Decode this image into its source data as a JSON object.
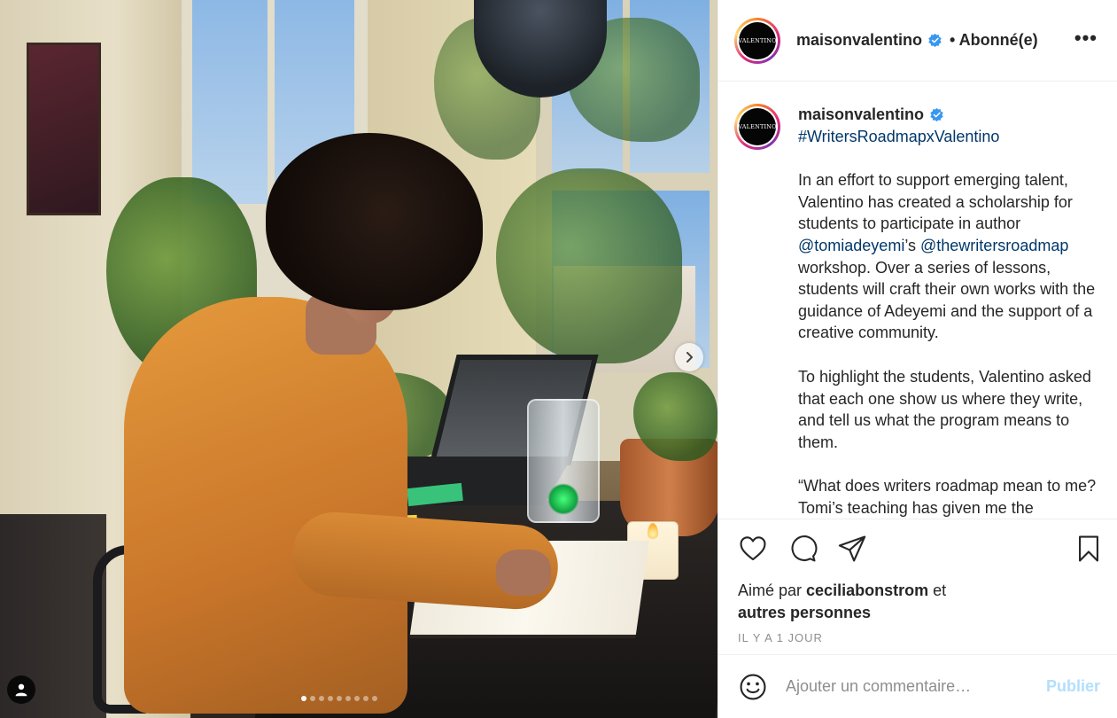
{
  "post": {
    "username": "maisonvalentino",
    "follow_status": "• Abonné(e)",
    "more_label": "•••",
    "avatar_text": "VALENTINO"
  },
  "caption": {
    "username": "maisonvalentino",
    "hashtag": "#WritersRoadmapxValentino",
    "p1_a": "In an effort to support emerging talent, Valentino has created a scholarship for students to participate in author ",
    "mention1": "@tomiadeyemi",
    "p1_b": "’s ",
    "mention2": "@thewritersroadmap",
    "p1_c": " workshop. Over a series of lessons, students will craft their own works with the guidance of Adeyemi and the support of a creative community.",
    "p2": "To highlight the students, Valentino asked that each one show us where they write, and tell us what the program means to them.",
    "p3": "“What does writers roadmap mean to me? Tomi’s teaching has given me the"
  },
  "likes": {
    "prefix": "Aimé par ",
    "user": "ceciliabonstrom",
    "suffix": " et",
    "others": "autres personnes"
  },
  "timestamp": "IL Y A 1 JOUR",
  "comment_box": {
    "placeholder": "Ajouter un commentaire…",
    "publish_label": "Publier"
  },
  "carousel": {
    "total": 9,
    "active_index": 0
  },
  "colors": {
    "link": "#00376b",
    "verified": "#3897f0",
    "publish_disabled": "#b2dffc",
    "timestamp": "#8e8e8e"
  }
}
